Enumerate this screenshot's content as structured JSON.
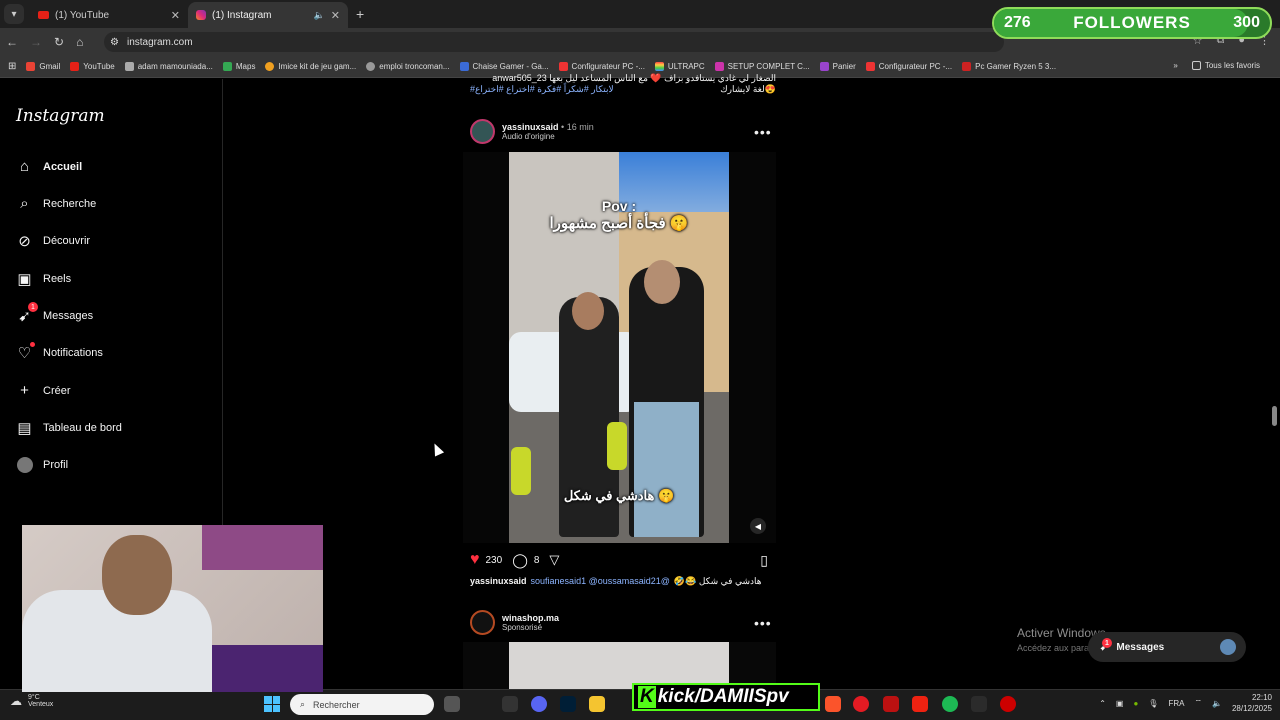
{
  "browser": {
    "tabs": [
      {
        "label": "(1) YouTube",
        "icon": "youtube-icon"
      },
      {
        "label": "(1) Instagram",
        "icon": "instagram-icon",
        "active": true
      }
    ],
    "url": "instagram.com",
    "bookmarks": [
      "Gmail",
      "YouTube",
      "adam mamouniada...",
      "Maps",
      "Imice kit de jeu gam...",
      "emploi troncoman...",
      "Chaise Gamer - Ga...",
      "Configurateur PC -...",
      "ULTRAPC",
      "SETUP COMPLET C...",
      "Panier",
      "Configurateur PC -...",
      "Pc Gamer Ryzen 5 3..."
    ],
    "all_favorites": "Tous les favoris"
  },
  "overlay": {
    "current": "276",
    "label": "FOLLOWERS",
    "goal": "300",
    "progress": 0.92
  },
  "instagram": {
    "logo": "Instagram",
    "nav": [
      {
        "label": "Accueil",
        "icon": "home-icon"
      },
      {
        "label": "Recherche",
        "icon": "search-icon"
      },
      {
        "label": "Découvrir",
        "icon": "compass-icon"
      },
      {
        "label": "Reels",
        "icon": "reels-icon"
      },
      {
        "label": "Messages",
        "icon": "messenger-icon",
        "badge": "1"
      },
      {
        "label": "Notifications",
        "icon": "heart-icon"
      },
      {
        "label": "Créer",
        "icon": "plus-icon"
      },
      {
        "label": "Tableau de bord",
        "icon": "dashboard-icon"
      },
      {
        "label": "Profil",
        "icon": "avatar-icon"
      }
    ],
    "prev_caption_line1": "anwar505_23 الصغار لي غادي يستافدو بزاف ❤️ مع الناس المساعد ليل بعها",
    "prev_caption_line2": "لغة لايشارك😍",
    "prev_caption_tags": "#لابتكار #شكراً #فكرة #اختراع #اختراع",
    "post": {
      "username": "yassinuxsaid",
      "time": "16 min",
      "audio": "Audio d'origine",
      "video_text_top": "Pov :",
      "video_text_mid": "فجأة أصبح مشهورا 🤫",
      "video_text_bottom": "هادشي في شكل 🤫",
      "likes": "230",
      "comments": "8",
      "caption_user": "yassinuxsaid",
      "caption_mentions": "soufianesaid1 @oussamasaid21@",
      "caption_text": "🤣😂 هادشي في شكل"
    },
    "post2": {
      "username": "winashop.ma",
      "sub": "Sponsorisé"
    },
    "messages_pill": {
      "label": "Messages",
      "badge": "1"
    }
  },
  "windows": {
    "activate_title": "Activer Windows",
    "activate_sub": "Accédez aux paramètres pour activer Windows.",
    "weather_temp": "9°C",
    "weather_desc": "Venteux",
    "search_placeholder": "Rechercher",
    "language": "FRA",
    "time": "22:10",
    "date": "28/12/2025"
  },
  "stream": {
    "kick_label": "kick/DAMIISpv"
  },
  "colors": {
    "accent": "#0095f6",
    "like": "#ff3040",
    "kick": "#53fc18",
    "overlay_green": "#2a7a2a"
  }
}
